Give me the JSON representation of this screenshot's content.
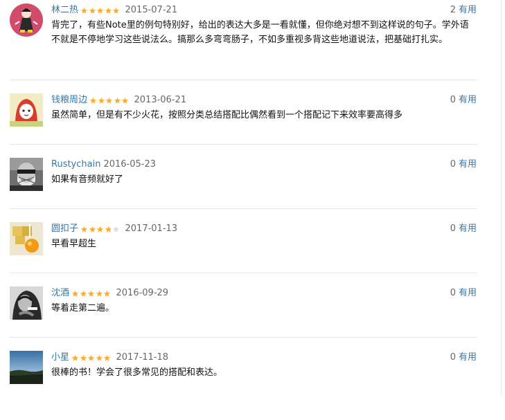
{
  "comments": [
    {
      "user": "林二热",
      "rating": 5,
      "date": "2015-07-21",
      "votes": "2",
      "useful_label": "有用",
      "text": "背完了，有些Note里的例句特别好，给出的表达大多是一看就懂，但你绝对想不到这样说的句子。学外语不就是不停地学习这些说法么。搞那么多弯弯肠子，不如多重视多背这些地道说法，把基础打扎实。",
      "avatar_icon": "cartoon-figure-avatar"
    },
    {
      "user": "钱粮周边",
      "rating": 5,
      "date": "2013-06-21",
      "votes": "0",
      "useful_label": "有用",
      "text": "虽然简单，但是有不少火花，按照分类总结搭配比偶然看到一个搭配记下来效率要高得多",
      "avatar_icon": "red-hooded-character-avatar"
    },
    {
      "user": "Rustychain",
      "rating": 0,
      "date": "2016-05-23",
      "votes": "0",
      "useful_label": "有用",
      "text": "如果有音频就好了",
      "avatar_icon": "masked-man-photo-avatar"
    },
    {
      "user": "圆扣子",
      "rating": 4,
      "date": "2017-01-13",
      "votes": "0",
      "useful_label": "有用",
      "text": "早看早超生",
      "avatar_icon": "orange-candy-photo-avatar"
    },
    {
      "user": "沈酒",
      "rating": 5,
      "date": "2016-09-29",
      "votes": "0",
      "useful_label": "有用",
      "text": "等着走第二遍。",
      "avatar_icon": "bw-portrait-photo-avatar"
    },
    {
      "user": "小星",
      "rating": 5,
      "date": "2017-11-18",
      "votes": "0",
      "useful_label": "有用",
      "text": "很棒的书！学会了很多常见的搭配和表达。",
      "avatar_icon": "sunset-landscape-avatar"
    }
  ],
  "colors": {
    "link": "#3377aa",
    "star_filled": "#ffac2d",
    "star_empty": "#dddddd",
    "meta": "#666666",
    "divider": "#e5e5e5"
  }
}
